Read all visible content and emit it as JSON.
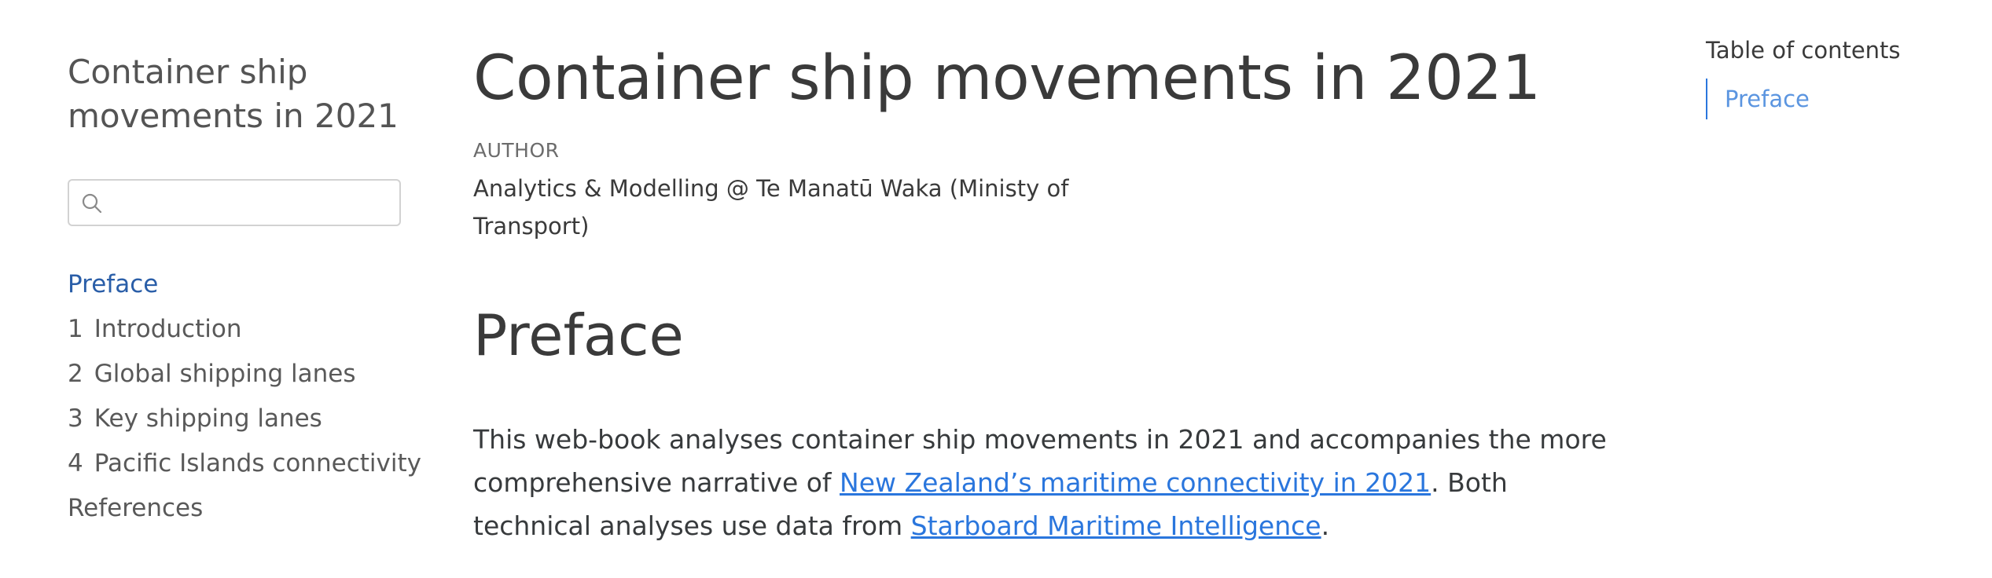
{
  "sidebar": {
    "title_line1": "Container ship",
    "title_line2": "movements in 2021",
    "search": {
      "value": "",
      "placeholder": ""
    },
    "items": [
      {
        "num": "",
        "label": "Preface"
      },
      {
        "num": "1",
        "label": "Introduction"
      },
      {
        "num": "2",
        "label": "Global shipping lanes"
      },
      {
        "num": "3",
        "label": "Key shipping lanes"
      },
      {
        "num": "4",
        "label": "Pacific Islands connectivity"
      },
      {
        "num": "",
        "label": "References"
      }
    ]
  },
  "main": {
    "title": "Container ship movements in 2021",
    "author_label": "AUTHOR",
    "author_name": "Analytics & Modelling @ Te Manatū Waka (Ministy of Transport)",
    "section_heading": "Preface",
    "paragraph": {
      "text_before": "This web-book analyses container ship movements in 2021 and accompanies the more comprehensive narrative of ",
      "link1": "New Zealand’s maritime connectivity in 2021",
      "text_middle": ". Both technical analyses use data from ",
      "link2": "Starboard Maritime Intelligence",
      "text_after": "."
    }
  },
  "toc": {
    "title": "Table of contents",
    "items": [
      {
        "label": "Preface"
      }
    ]
  },
  "colors": {
    "active_nav": "#2a5ea8",
    "link": "#2a76dd",
    "toc_link": "#5b95e0"
  },
  "icons": {
    "search": "search-icon"
  }
}
